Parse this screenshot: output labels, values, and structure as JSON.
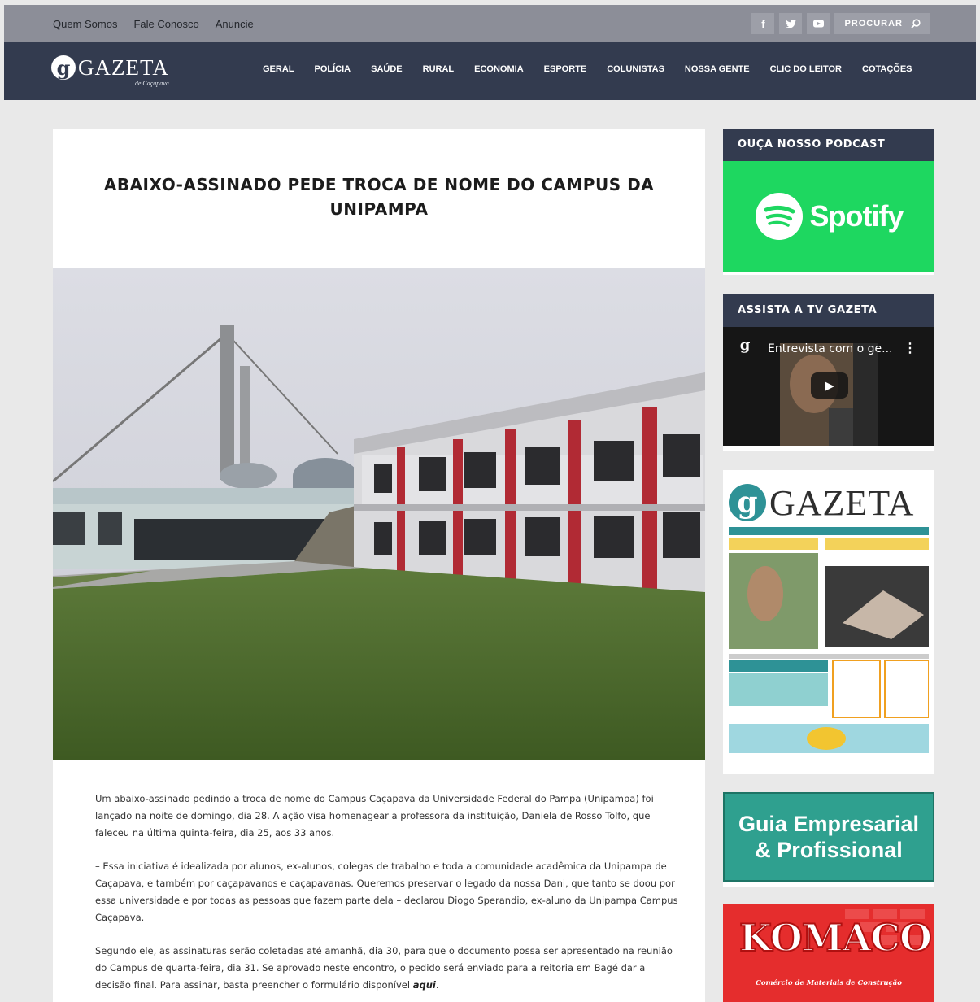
{
  "topbar": {
    "links": [
      "Quem Somos",
      "Fale Conosco",
      "Anuncie"
    ],
    "social": [
      "facebook-icon",
      "twitter-icon",
      "youtube-icon"
    ],
    "search_label": "PROCURAR"
  },
  "logo": {
    "name": "GAZETA",
    "sub": "de Caçapava"
  },
  "nav": [
    "GERAL",
    "POLÍCIA",
    "SAÚDE",
    "RURAL",
    "ECONOMIA",
    "ESPORTE",
    "COLUNISTAS",
    "NOSSA GENTE",
    "CLIC DO LEITOR",
    "COTAÇÕES"
  ],
  "article": {
    "title": "ABAIXO-ASSINADO PEDE TROCA DE NOME DO CAMPUS DA UNIPAMPA",
    "p1": "Um abaixo-assinado pedindo a troca de nome do Campus Caçapava da Universidade Federal do Pampa (Unipampa) foi lançado na noite de domingo, dia 28. A ação visa homenagear a professora da instituição, Daniela de Rosso Tolfo, que faleceu na última quinta-feira, dia 25, aos 33 anos.",
    "p2": "– Essa iniciativa é idealizada por alunos, ex-alunos, colegas de trabalho e toda a comunidade acadêmica da Unipampa de Caçapava, e também por caçapavanos e caçapavanas. Queremos preservar o legado da nossa Dani, que tanto se doou por essa universidade e por todas as pessoas que fazem parte dela – declarou Diogo Sperandio, ex-aluno da Unipampa Campus Caçapava.",
    "p3": "Segundo ele, as assinaturas serão coletadas até amanhã, dia 30, para que o documento possa ser apresentado na reunião do Campus de quarta-feira, dia 31. Se aprovado neste encontro, o pedido será enviado para a reitoria em Bagé dar a decisão final. Para assinar, basta preencher o formulário disponível ",
    "p3_link": "aqui",
    "p3_end": "."
  },
  "sidebar": {
    "podcast_title": "OUÇA NOSSO PODCAST",
    "spotify": "Spotify",
    "tv_title": "ASSISTA A TV GAZETA",
    "video_title": "Entrevista com o ge...",
    "paper_name": "GAZETA",
    "guia_line1": "Guia Empresarial",
    "guia_line2": "& Profissional",
    "komaco_name": "KOMACO",
    "komaco_sub": "Comércio de Materiais de Construção"
  },
  "colors": {
    "nav": "#333b4f",
    "topbar": "#8c8e98",
    "spotify": "#1ed760",
    "guia": "#2fa08f",
    "komaco": "#e52d2d"
  }
}
